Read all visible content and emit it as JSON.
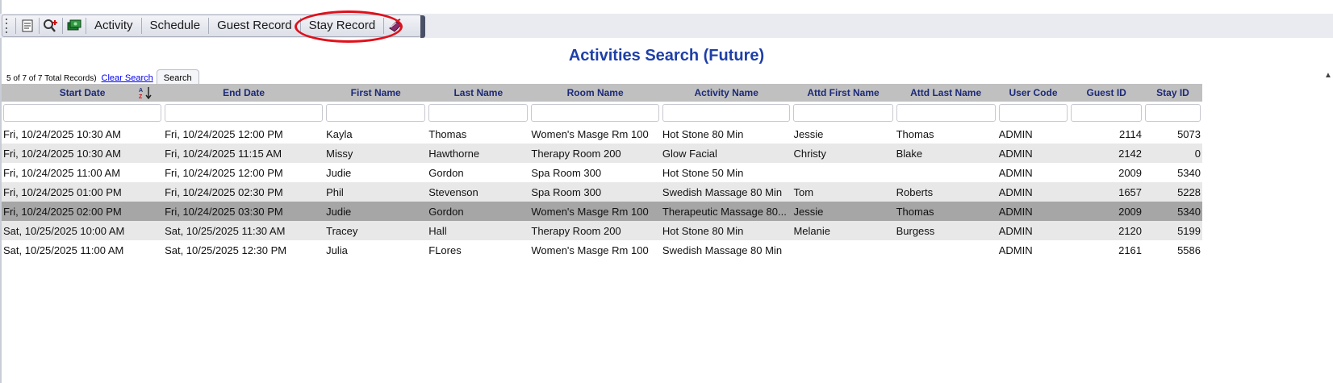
{
  "toolbar": {
    "buttons": [
      "Activity",
      "Schedule",
      "Guest Record",
      "Stay Record"
    ],
    "icons": [
      "grip-icon",
      "notes-icon",
      "search-add-icon",
      "cash-icon",
      "book-icon"
    ]
  },
  "colors": {
    "title": "#1e3fa8",
    "header_bg": "#c0c0c0",
    "header_text": "#1c2a78",
    "selected_row": "#a6a6a6",
    "alt_row": "#e8e8e8",
    "highlight": "#e0101a"
  },
  "page_title": "Activities Search (Future)",
  "records_text": "5 of 7 of 7 Total Records)",
  "clear_search": "Clear Search",
  "search_button": "Search",
  "columns": [
    "Start Date",
    "End Date",
    "First Name",
    "Last Name",
    "Room Name",
    "Activity Name",
    "Attd First Name",
    "Attd Last Name",
    "User Code",
    "Guest ID",
    "Stay ID"
  ],
  "rows": [
    {
      "start": "Fri, 10/24/2025 10:30 AM",
      "end": "Fri, 10/24/2025 12:00 PM",
      "first": "Kayla",
      "last": "Thomas",
      "room": "Women's Masge Rm 100",
      "activity": "Hot Stone 80 Min",
      "attd_first": "Jessie",
      "attd_last": "Thomas",
      "user": "ADMIN",
      "guest_id": "2114",
      "stay_id": "5073"
    },
    {
      "start": "Fri, 10/24/2025 10:30 AM",
      "end": "Fri, 10/24/2025 11:15 AM",
      "first": "Missy",
      "last": "Hawthorne",
      "room": "Therapy Room 200",
      "activity": "Glow Facial",
      "attd_first": "Christy",
      "attd_last": "Blake",
      "user": "ADMIN",
      "guest_id": "2142",
      "stay_id": "0"
    },
    {
      "start": "Fri, 10/24/2025 11:00 AM",
      "end": "Fri, 10/24/2025 12:00 PM",
      "first": "Judie",
      "last": "Gordon",
      "room": "Spa Room 300",
      "activity": "Hot Stone 50 Min",
      "attd_first": "",
      "attd_last": "",
      "user": "ADMIN",
      "guest_id": "2009",
      "stay_id": "5340"
    },
    {
      "start": "Fri, 10/24/2025 01:00 PM",
      "end": "Fri, 10/24/2025 02:30 PM",
      "first": "Phil",
      "last": "Stevenson",
      "room": "Spa Room 300",
      "activity": "Swedish Massage 80 Min",
      "attd_first": "Tom",
      "attd_last": "Roberts",
      "user": "ADMIN",
      "guest_id": "1657",
      "stay_id": "5228"
    },
    {
      "start": "Fri, 10/24/2025 02:00 PM",
      "end": "Fri, 10/24/2025 03:30 PM",
      "first": "Judie",
      "last": "Gordon",
      "room": "Women's Masge Rm 100",
      "activity": "Therapeutic Massage 80...",
      "attd_first": "Jessie",
      "attd_last": "Thomas",
      "user": "ADMIN",
      "guest_id": "2009",
      "stay_id": "5340"
    },
    {
      "start": "Sat, 10/25/2025 10:00 AM",
      "end": "Sat, 10/25/2025 11:30 AM",
      "first": "Tracey",
      "last": "Hall",
      "room": "Therapy Room 200",
      "activity": "Hot Stone 80 Min",
      "attd_first": "Melanie",
      "attd_last": "Burgess",
      "user": "ADMIN",
      "guest_id": "2120",
      "stay_id": "5199"
    },
    {
      "start": "Sat, 10/25/2025 11:00 AM",
      "end": "Sat, 10/25/2025 12:30 PM",
      "first": "Julia",
      "last": "FLores",
      "room": "Women's Masge Rm 100",
      "activity": "Swedish Massage 80 Min",
      "attd_first": "",
      "attd_last": "",
      "user": "ADMIN",
      "guest_id": "2161",
      "stay_id": "5586"
    }
  ],
  "selected_row_index": 4
}
